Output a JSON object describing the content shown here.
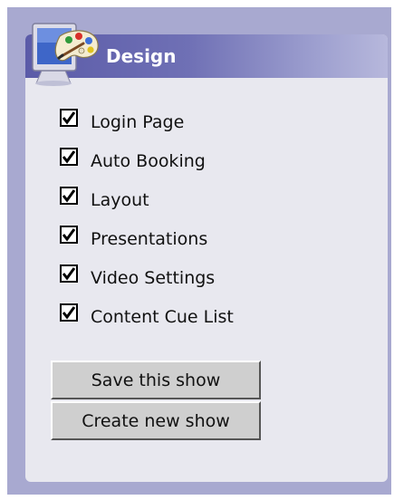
{
  "panel": {
    "title": "Design",
    "icon": "paint-palette-monitor-icon",
    "accent_color": "#5b5ba8",
    "background_color": "#a8a9d0"
  },
  "options": [
    {
      "label": "Login Page",
      "checked": true
    },
    {
      "label": "Auto Booking",
      "checked": true
    },
    {
      "label": "Layout",
      "checked": true
    },
    {
      "label": "Presentations",
      "checked": true
    },
    {
      "label": "Video Settings",
      "checked": true
    },
    {
      "label": "Content Cue List",
      "checked": true
    }
  ],
  "buttons": {
    "save_label": "Save this show",
    "create_label": "Create new show"
  }
}
